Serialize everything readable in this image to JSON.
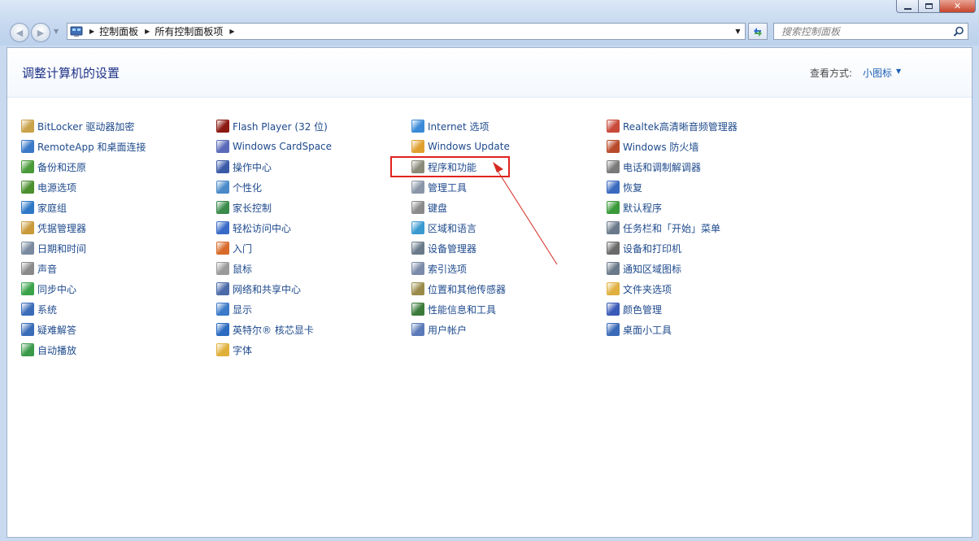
{
  "window": {
    "minimize_icon": "minimize-icon",
    "maximize_icon": "maximize-icon",
    "close_icon": "close-icon"
  },
  "address": {
    "crumbs": [
      "控制面板",
      "所有控制面板项"
    ]
  },
  "search": {
    "placeholder": "搜索控制面板"
  },
  "header": {
    "title": "调整计算机的设置",
    "view_by_label": "查看方式:",
    "view_by_value": "小图标"
  },
  "columns": [
    {
      "items": [
        {
          "label": "BitLocker 驱动器加密",
          "icon": "key-icon",
          "color": "#c9a24a"
        },
        {
          "label": "RemoteApp 和桌面连接",
          "icon": "remote-desktop-icon",
          "color": "#3a78c8"
        },
        {
          "label": "备份和还原",
          "icon": "backup-icon",
          "color": "#4a9a3a"
        },
        {
          "label": "电源选项",
          "icon": "power-icon",
          "color": "#4b8f2f"
        },
        {
          "label": "家庭组",
          "icon": "homegroup-icon",
          "color": "#2f78c6"
        },
        {
          "label": "凭据管理器",
          "icon": "vault-icon",
          "color": "#c89a3a"
        },
        {
          "label": "日期和时间",
          "icon": "clock-icon",
          "color": "#7a8aa0"
        },
        {
          "label": "声音",
          "icon": "speaker-icon",
          "color": "#8a8a8a"
        },
        {
          "label": "同步中心",
          "icon": "sync-icon",
          "color": "#3aa24a"
        },
        {
          "label": "系统",
          "icon": "system-icon",
          "color": "#3a6cb8"
        },
        {
          "label": "疑难解答",
          "icon": "troubleshoot-icon",
          "color": "#3a6cb8"
        },
        {
          "label": "自动播放",
          "icon": "autoplay-icon",
          "color": "#3a9a4a"
        }
      ]
    },
    {
      "items": [
        {
          "label": "Flash Player (32 位)",
          "icon": "flash-icon",
          "color": "#8c1a12"
        },
        {
          "label": "Windows CardSpace",
          "icon": "cardspace-icon",
          "color": "#5a6ab8"
        },
        {
          "label": "操作中心",
          "icon": "flag-icon",
          "color": "#3a5aa8"
        },
        {
          "label": "个性化",
          "icon": "personalize-icon",
          "color": "#4a8ac8"
        },
        {
          "label": "家长控制",
          "icon": "parental-control-icon",
          "color": "#3a8a4a"
        },
        {
          "label": "轻松访问中心",
          "icon": "ease-of-access-icon",
          "color": "#3a6ac8"
        },
        {
          "label": "入门",
          "icon": "getting-started-icon",
          "color": "#d86a2a"
        },
        {
          "label": "鼠标",
          "icon": "mouse-icon",
          "color": "#9a9a9a"
        },
        {
          "label": "网络和共享中心",
          "icon": "network-icon",
          "color": "#4a6aa8"
        },
        {
          "label": "显示",
          "icon": "display-icon",
          "color": "#3a7ac8"
        },
        {
          "label": "英特尔® 核芯显卡",
          "icon": "intel-graphics-icon",
          "color": "#2a6ac0"
        },
        {
          "label": "字体",
          "icon": "fonts-icon",
          "color": "#e0b03a"
        }
      ]
    },
    {
      "items": [
        {
          "label": "Internet 选项",
          "icon": "internet-options-icon",
          "color": "#3a8ad8"
        },
        {
          "label": "Windows Update",
          "icon": "windows-update-icon",
          "color": "#e0a030"
        },
        {
          "label": "程序和功能",
          "icon": "programs-icon",
          "color": "#8a8a7a"
        },
        {
          "label": "管理工具",
          "icon": "admin-tools-icon",
          "color": "#8a96a8"
        },
        {
          "label": "键盘",
          "icon": "keyboard-icon",
          "color": "#8a8a8a"
        },
        {
          "label": "区域和语言",
          "icon": "globe-icon",
          "color": "#3a9ad0"
        },
        {
          "label": "设备管理器",
          "icon": "device-manager-icon",
          "color": "#6a7a8a"
        },
        {
          "label": "索引选项",
          "icon": "indexing-icon",
          "color": "#7a8aa8"
        },
        {
          "label": "位置和其他传感器",
          "icon": "sensor-icon",
          "color": "#9a8a4a"
        },
        {
          "label": "性能信息和工具",
          "icon": "performance-icon",
          "color": "#3a7a3a"
        },
        {
          "label": "用户帐户",
          "icon": "users-icon",
          "color": "#5a7ab8"
        }
      ]
    },
    {
      "items": [
        {
          "label": "Realtek高清晰音频管理器",
          "icon": "audio-manager-icon",
          "color": "#c84a3a"
        },
        {
          "label": "Windows 防火墙",
          "icon": "firewall-icon",
          "color": "#b84a2a"
        },
        {
          "label": "电话和调制解调器",
          "icon": "phone-modem-icon",
          "color": "#7a7a7a"
        },
        {
          "label": "恢复",
          "icon": "recovery-icon",
          "color": "#3a6ac0"
        },
        {
          "label": "默认程序",
          "icon": "default-programs-icon",
          "color": "#3a9a3a"
        },
        {
          "label": "任务栏和「开始」菜单",
          "icon": "taskbar-icon",
          "color": "#6a7a8a"
        },
        {
          "label": "设备和打印机",
          "icon": "printer-icon",
          "color": "#6a6a6a"
        },
        {
          "label": "通知区域图标",
          "icon": "notification-area-icon",
          "color": "#6a7a8a"
        },
        {
          "label": "文件夹选项",
          "icon": "folder-options-icon",
          "color": "#e0b040"
        },
        {
          "label": "颜色管理",
          "icon": "color-management-icon",
          "color": "#3a5ab8"
        },
        {
          "label": "桌面小工具",
          "icon": "gadgets-icon",
          "color": "#3a6ab8"
        }
      ]
    }
  ],
  "annotation": {
    "highlight_color": "#e0231f"
  }
}
